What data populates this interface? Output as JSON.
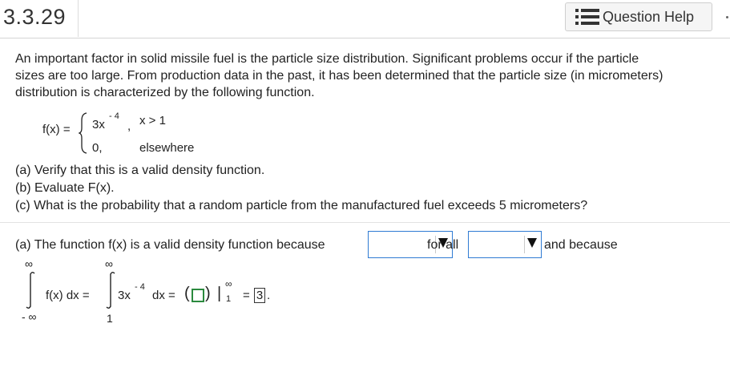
{
  "header": {
    "problem_number": "3.3.29",
    "help_button_label": "Question Help"
  },
  "problem": {
    "intro": [
      "An important factor in solid missile fuel is the particle size distribution. Significant problems occur if the particle",
      "sizes are too large. From production data in the past, it has been determined that the particle size (in micrometers)",
      "distribution is characterized by the following function."
    ],
    "function": {
      "lhs": "f(x) =",
      "case1_coef": "3x",
      "case1_exponent": "- 4",
      "case1_comma": ",",
      "case1_condition": "x > 1",
      "case2_value": "0,",
      "case2_condition": "elsewhere"
    },
    "questions": [
      "(a) Verify that this is a valid density function.",
      "(b) Evaluate F(x).",
      "(c) What is the probability that a random particle from the manufactured fuel exceeds 5 micrometers?"
    ]
  },
  "answer_a": {
    "text_before": "(a) The function f(x) is a valid density function because",
    "text_middle": "for all",
    "text_after": "and because",
    "dropdown1_value": "",
    "dropdown2_value": "",
    "integral": {
      "upper1": "∞",
      "lower1": "- ∞",
      "integrand1": "f(x) dx =",
      "upper2": "∞",
      "lower2": "1",
      "integrand2_coef": "3x",
      "integrand2_exp": "- 4",
      "integrand2_dx": "dx =",
      "open_paren": "(",
      "close_paren": ")",
      "eval_bar": "|",
      "eval_upper": "∞",
      "eval_lower": "1",
      "equals": "=",
      "result": "3",
      "period": "."
    }
  }
}
